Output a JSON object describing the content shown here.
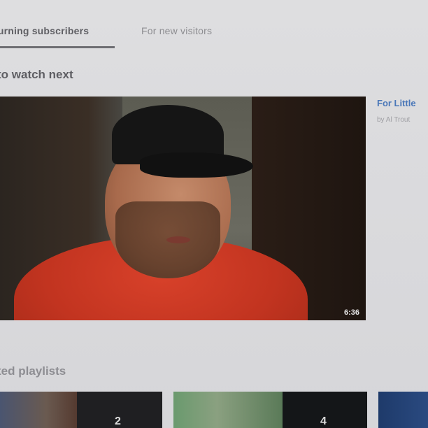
{
  "tabs": [
    {
      "label": "turning subscribers",
      "active": true
    },
    {
      "label": "For new visitors",
      "active": false
    }
  ],
  "sections": {
    "watch_next": "to watch next",
    "playlists": "ted playlists"
  },
  "featured_video": {
    "duration": "6:36"
  },
  "side_video": {
    "title": "For Little",
    "author": "by Al Trout"
  },
  "playlists": [
    {
      "count": "2"
    },
    {
      "count": "4"
    },
    {
      "count": ""
    }
  ],
  "colors": {
    "link": "#4a77b8",
    "background": "#dcdcde"
  }
}
